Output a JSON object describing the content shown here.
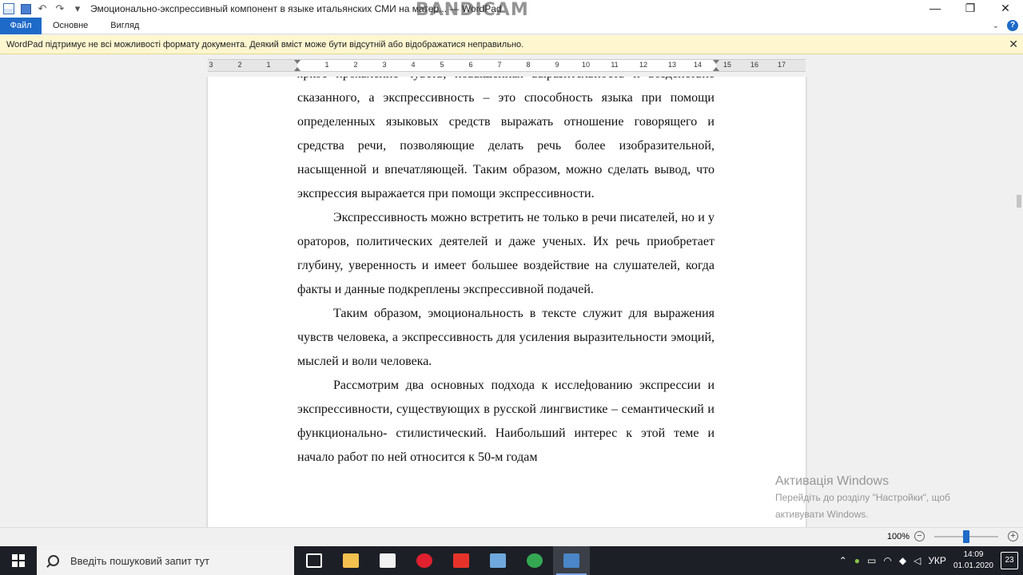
{
  "window": {
    "title": "Эмоционально-экспрессивный компонент в языке итальянских СМИ на матер... — WordPad",
    "watermark": "BANDICAM"
  },
  "ribbon": {
    "tabs": [
      {
        "label": "Файл"
      },
      {
        "label": "Основне"
      },
      {
        "label": "Вигляд"
      }
    ]
  },
  "infobar": {
    "message": "WordPad підтримує не всі можливості формату документа. Деякий вміст може бути відсутній або відображатися неправильно."
  },
  "ruler": {
    "labels": [
      "3",
      "2",
      "1",
      "1",
      "2",
      "3",
      "4",
      "5",
      "6",
      "7",
      "8",
      "9",
      "10",
      "11",
      "12",
      "13",
      "14",
      "15",
      "16",
      "17"
    ]
  },
  "document": {
    "paragraphs": [
      "яркое проявление чувств, повышенная выразительность и воздействие сказанного, а экспрессивность – это способность языка при помощи определенных языковых средств выражать отношение говорящего и средства речи, позволяющие делать речь более изобразительной, насыщенной и впечатляющей. Таким образом, можно сделать вывод, что экспрессия выражается при помощи экспрессивности.",
      "Экспрессивность можно встретить не только в речи писателей, но и у ораторов, политических деятелей и даже ученых. Их речь приобретает глубину, уверенность и имеет большее воздействие на слушателей, когда факты и данные подкреплены экспрессивной подачей.",
      "Таким образом, эмоциональность в тексте служит для выражения чувств человека, а экспрессивность для усиления выразительности эмоций, мыслей и воли человека.",
      "Рассмотрим два основных подхода к исследованию экспрессии и экспрессивности, существующих в русской лингвистике – семантический и функционально- стилистический. Наибольший интерес к этой теме и начало работ по ней относится к 50-м годам"
    ]
  },
  "activation": {
    "title": "Активація Windows",
    "line1": "Перейдіть до розділу \"Настройки\", щоб",
    "line2": "активувати Windows."
  },
  "statusbar": {
    "zoom": "100%",
    "zoom_level_percent": 100
  },
  "taskbar": {
    "search_placeholder": "Введіть пошуковий запит тут",
    "language": "УКР",
    "time": "14:09",
    "date": "01.01.2020",
    "notifications": "23",
    "apps": [
      {
        "name": "task-view",
        "color": "#ffffff"
      },
      {
        "name": "file-explorer",
        "color": "#f2c14e"
      },
      {
        "name": "store",
        "color": "#f2f2f2"
      },
      {
        "name": "opera",
        "color": "#e0202f"
      },
      {
        "name": "yandex",
        "color": "#e6332a"
      },
      {
        "name": "paint",
        "color": "#6fa8dc"
      },
      {
        "name": "chrome",
        "color": "#34a853"
      },
      {
        "name": "wordpad",
        "color": "#4a86c8"
      }
    ]
  }
}
